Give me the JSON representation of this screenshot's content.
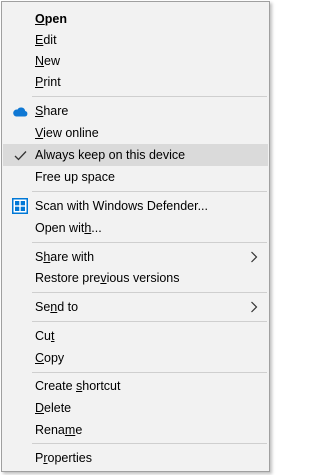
{
  "menu": {
    "items": [
      {
        "label": "Open",
        "underline": "O",
        "bold": true
      },
      {
        "label": "Edit",
        "underline": "E"
      },
      {
        "label": "New",
        "underline": "N"
      },
      {
        "label": "Print",
        "underline": "P"
      },
      {
        "label": "Share",
        "underline": "S",
        "icon": "onedrive-cloud-icon"
      },
      {
        "label": "View online",
        "underline": "V"
      },
      {
        "label": "Always keep on this device",
        "icon": "checkmark-icon",
        "selected": true
      },
      {
        "label": "Free up space"
      },
      {
        "label": "Scan with Windows Defender...",
        "icon": "windows-defender-icon"
      },
      {
        "label": "Open with...",
        "underline": "h"
      },
      {
        "label": "Share with",
        "underline": "h",
        "submenu": true
      },
      {
        "label": "Restore previous versions",
        "underline": "v"
      },
      {
        "label": "Send to",
        "underline": "n",
        "submenu": true
      },
      {
        "label": "Cut",
        "underline": "t"
      },
      {
        "label": "Copy",
        "underline": "C"
      },
      {
        "label": "Create shortcut",
        "underline": "s"
      },
      {
        "label": "Delete",
        "underline": "D"
      },
      {
        "label": "Rename",
        "underline": "m"
      },
      {
        "label": "Properties",
        "underline": "r"
      }
    ]
  },
  "colors": {
    "menu_background": "#f2f2f2",
    "highlight": "#dadada",
    "separator": "#cfcfcf",
    "onedrive_blue": "#0f78d4",
    "defender_blue": "#0078d7"
  }
}
